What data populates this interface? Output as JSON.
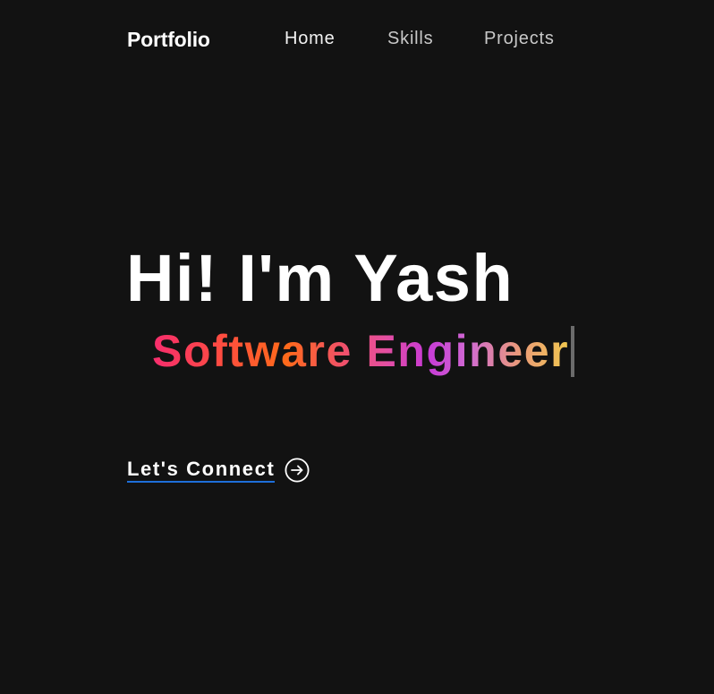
{
  "navbar": {
    "brand": "Portfolio",
    "links": [
      {
        "label": "Home",
        "active": true
      },
      {
        "label": "Skills",
        "active": false
      },
      {
        "label": "Projects",
        "active": false
      }
    ]
  },
  "hero": {
    "title": "Hi! I'm Yash",
    "subtitle": "Software Engineer",
    "cta_label": "Let's Connect",
    "cta_icon": "arrow-right-circle-icon"
  },
  "colors": {
    "background": "#121212",
    "text": "#ffffff",
    "nav_inactive": "#c8c8c8",
    "cta_underline": "#1e6fd9",
    "gradient": [
      "#f72d6e",
      "#ff6a1a",
      "#c73ad6",
      "#f2c84e"
    ]
  }
}
